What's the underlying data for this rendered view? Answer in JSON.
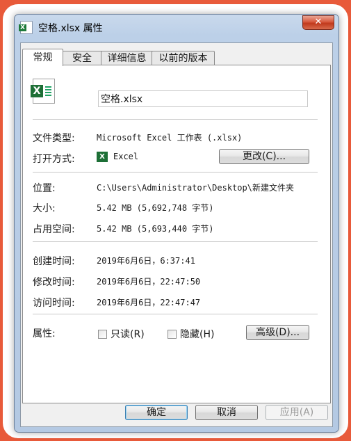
{
  "window": {
    "title": "空格.xlsx 属性",
    "close_glyph": "✕",
    "title_icon_glyph": "X"
  },
  "tabs": [
    {
      "label": "常规",
      "active": true
    },
    {
      "label": "安全",
      "active": false
    },
    {
      "label": "详细信息",
      "active": false
    },
    {
      "label": "以前的版本",
      "active": false
    }
  ],
  "general": {
    "icon_glyph": "X",
    "filename": "空格.xlsx",
    "file_type_label": "文件类型:",
    "file_type_value": "Microsoft Excel 工作表 (.xlsx)",
    "open_with_label": "打开方式:",
    "open_with_value": "Excel",
    "open_with_icon_glyph": "X",
    "change_button": "更改(C)...",
    "location_label": "位置:",
    "location_value": "C:\\Users\\Administrator\\Desktop\\新建文件夹",
    "size_label": "大小:",
    "size_value": "5.42 MB (5,692,748 字节)",
    "size_on_disk_label": "占用空间:",
    "size_on_disk_value": "5.42 MB (5,693,440 字节)",
    "created_label": "创建时间:",
    "created_value": "2019年6月6日，6:37:41",
    "modified_label": "修改时间:",
    "modified_value": "2019年6月6日，22:47:50",
    "accessed_label": "访问时间:",
    "accessed_value": "2019年6月6日，22:47:47",
    "attributes_label": "属性:",
    "readonly_label": "只读(R)",
    "readonly_checked": false,
    "hidden_label": "隐藏(H)",
    "hidden_checked": false,
    "advanced_button": "高级(D)..."
  },
  "footer": {
    "ok": "确定",
    "cancel": "取消",
    "apply": "应用(A)"
  }
}
